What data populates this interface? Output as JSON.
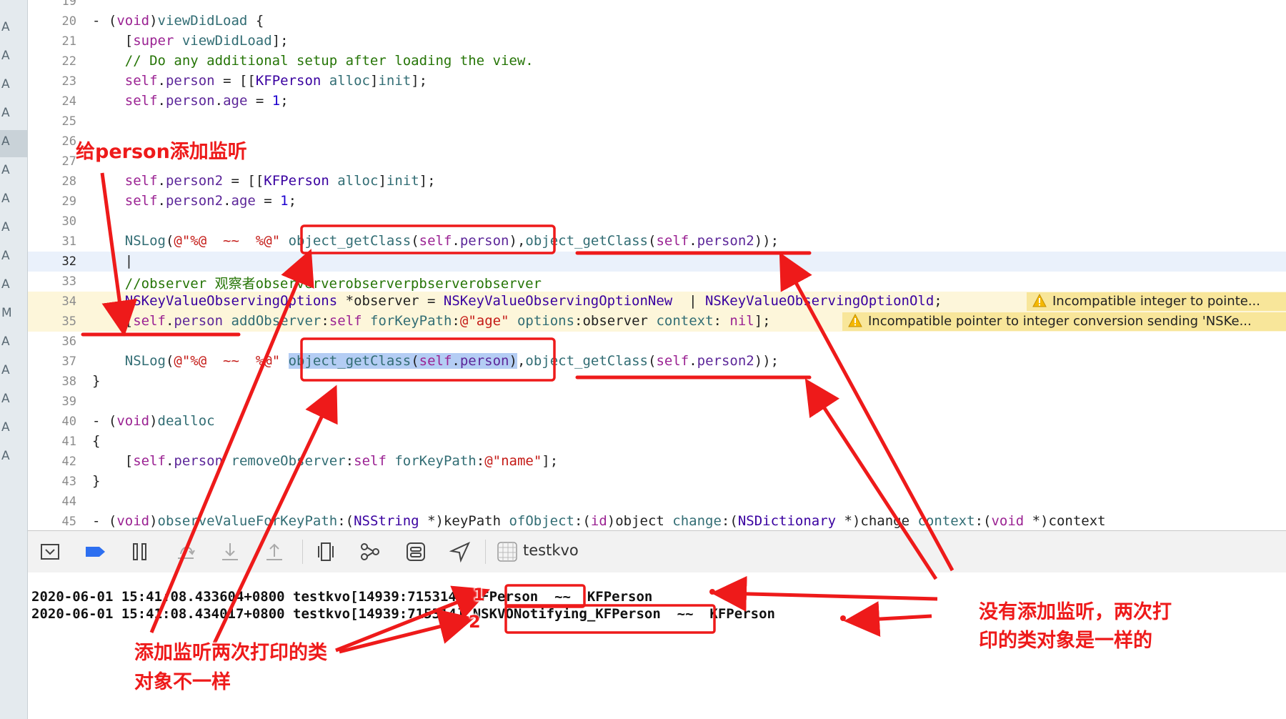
{
  "left_strip": {
    "letters": [
      "A",
      "A",
      "A",
      "A",
      "A",
      "A",
      "A",
      "A",
      "A",
      "A",
      "M",
      "A",
      "A",
      "A",
      "A",
      "A"
    ]
  },
  "editor": {
    "lines": [
      {
        "n": "19",
        "html": ""
      },
      {
        "n": "20",
        "html": "- (<span class=\"kw\">void</span>)<span class=\"meth\">viewDidLoad</span> {"
      },
      {
        "n": "21",
        "html": "    [<span class=\"kw\">super</span> <span class=\"meth\">viewDidLoad</span>];"
      },
      {
        "n": "22",
        "html": "    <span class=\"cmt\">// Do any additional setup after loading the view.</span>"
      },
      {
        "n": "23",
        "html": "    <span class=\"kw\">self</span>.<span class=\"prop\">person</span> = [[<span class=\"cls\">KFPerson</span> <span class=\"meth\">alloc</span>]<span class=\"meth\">init</span>];"
      },
      {
        "n": "24",
        "html": "    <span class=\"kw\">self</span>.<span class=\"prop\">person</span>.<span class=\"prop\">age</span> = <span class=\"num\">1</span>;"
      },
      {
        "n": "25",
        "html": ""
      },
      {
        "n": "26",
        "html": ""
      },
      {
        "n": "27",
        "html": ""
      },
      {
        "n": "28",
        "html": "    <span class=\"kw\">self</span>.<span class=\"prop\">person2</span> = [[<span class=\"cls\">KFPerson</span> <span class=\"meth\">alloc</span>]<span class=\"meth\">init</span>];"
      },
      {
        "n": "29",
        "html": "    <span class=\"kw\">self</span>.<span class=\"prop\">person2</span>.<span class=\"prop\">age</span> = <span class=\"num\">1</span>;"
      },
      {
        "n": "30",
        "html": ""
      },
      {
        "n": "31",
        "html": "    <span class=\"meth\">NSLog</span>(<span class=\"str\">@\"%@  ~~  %@\"</span> <span class=\"meth\">object_getClass</span>(<span class=\"kw\">self</span>.<span class=\"prop\">person</span>),<span class=\"meth\">object_getClass</span>(<span class=\"kw\">self</span>.<span class=\"prop\">person2</span>));"
      },
      {
        "n": "32",
        "html": "    |"
      },
      {
        "n": "33",
        "html": "    <span class=\"cmt\">//observer 观察者obserververobserverpbserverobserver</span>"
      },
      {
        "n": "34",
        "html": "    <span class=\"cls\">NSKeyValueObservingOptions</span> *observer = <span class=\"cls\">NSKeyValueObservingOptionNew</span>  | <span class=\"cls\">NSKeyValueObservingOptionOld</span>;"
      },
      {
        "n": "35",
        "html": "    [<span class=\"kw\">self</span>.<span class=\"prop\">person</span> <span class=\"meth\">addObserver</span>:<span class=\"kw\">self</span> <span class=\"meth\">forKeyPath</span>:<span class=\"str\">@\"age\"</span> <span class=\"meth\">options</span>:observer <span class=\"meth\">context</span>: <span class=\"kw\">nil</span>];"
      },
      {
        "n": "36",
        "html": ""
      },
      {
        "n": "37",
        "html": "    <span class=\"meth\">NSLog</span>(<span class=\"str\">@\"%@  ~~  %@\"</span> <span class=\"sel\"><span class=\"meth\">object_getClass</span>(<span class=\"kw\">self</span>.<span class=\"prop\">person</span>)</span>,<span class=\"meth\">object_getClass</span>(<span class=\"kw\">self</span>.<span class=\"prop\">person2</span>));"
      },
      {
        "n": "38",
        "html": "}"
      },
      {
        "n": "39",
        "html": ""
      },
      {
        "n": "40",
        "html": "- (<span class=\"kw\">void</span>)<span class=\"meth\">dealloc</span>"
      },
      {
        "n": "41",
        "html": "{"
      },
      {
        "n": "42",
        "html": "    [<span class=\"kw\">self</span>.<span class=\"prop\">person</span> <span class=\"meth\">removeObserver</span>:<span class=\"kw\">self</span> <span class=\"meth\">forKeyPath</span>:<span class=\"str\">@\"name\"</span>];"
      },
      {
        "n": "43",
        "html": "}"
      },
      {
        "n": "44",
        "html": ""
      },
      {
        "n": "45",
        "html": "- (<span class=\"kw\">void</span>)<span class=\"meth\">observeValueForKeyPath</span>:(<span class=\"cls\">NSString</span> *)keyPath <span class=\"meth\">ofObject</span>:(<span class=\"kw\">id</span>)object <span class=\"meth\">change</span>:(<span class=\"cls\">NSDictionary</span> *)change <span class=\"meth\">context</span>:(<span class=\"kw\">void</span> *)context"
      }
    ],
    "current_line": "32",
    "warning_lines": [
      "34",
      "35"
    ],
    "warnings": [
      {
        "line": "34",
        "text": "Incompatible integer to pointe..."
      },
      {
        "line": "35",
        "text": "Incompatible pointer to integer conversion sending 'NSKe..."
      }
    ]
  },
  "debug_bar": {
    "target": "testkvo",
    "icons": [
      "hide-console-icon",
      "breakpoints-icon",
      "pause-icon",
      "step-over-icon",
      "step-into-icon",
      "step-out-icon",
      "view-debugger-icon",
      "memory-graph-icon",
      "environment-overrides-icon",
      "location-icon",
      "app-target-icon"
    ]
  },
  "console": {
    "logs": [
      "2020-06-01 15:41:08.433604+0800 testkvo[14939:715314] KFPerson  ~~  KFPerson",
      "2020-06-01 15:41:08.434017+0800 testkvo[14939:715314] NSKVONotifying_KFPerson  ~~  KFPerson"
    ]
  },
  "annotations": {
    "add_listener": "给person添加监听",
    "diff_line1": "添加监听两次打印的类",
    "diff_line2": "对象不一样",
    "same_line1": "没有添加监听，两次打",
    "same_line2": "印的类对象是一样的",
    "num1": "1",
    "num2": "2",
    "color": "#ee1a1a"
  },
  "colors": {
    "keyword": "#9b2393",
    "class": "#3900a0",
    "string": "#c41a16",
    "number": "#1c00cf",
    "comment": "#267507",
    "warning_bg": "#f8e69a"
  }
}
